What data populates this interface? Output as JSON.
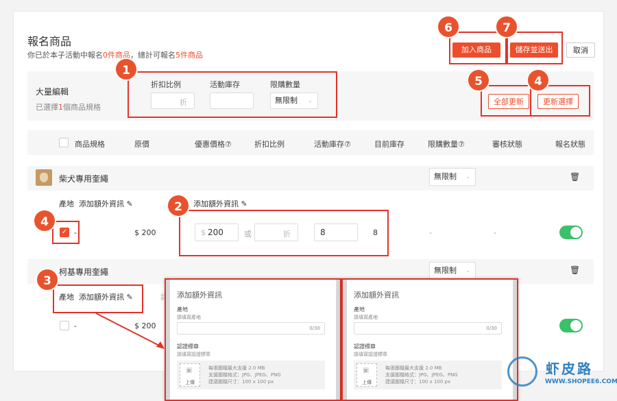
{
  "page": {
    "title": "報名商品",
    "subtitle_pre": "你已於本子活動中報名",
    "subtitle_c1": "0件商品",
    "subtitle_mid": "，總計可報名",
    "subtitle_c2": "5件商品"
  },
  "buttons": {
    "add": "加入商品",
    "save": "儲存並送出",
    "cancel": "取消",
    "update_all": "全部更新",
    "update_selected": "更新選擇"
  },
  "bulk": {
    "title": "大量編輯",
    "selected_pre": "已選擇",
    "selected_count": "1",
    "selected_post": "個商品規格",
    "discount_label": "折扣比例",
    "discount_unit": "折",
    "stock_label": "活動庫存",
    "limit_label": "限購數量",
    "limit_value": "無限制"
  },
  "table": {
    "headers": [
      "商品規格",
      "原價",
      "優惠價格⑦",
      "折扣比例",
      "活動庫存⑦",
      "目前庫存",
      "限購數量⑦",
      "審核狀態",
      "報名狀態"
    ]
  },
  "products": [
    {
      "name": "柴犬專用奎繩",
      "limit": "無限制",
      "info_label": "產地",
      "info_link": "添加額外資訊",
      "variant": "-",
      "price": "$ 200",
      "promo_currency": "$",
      "promo_price": "200",
      "or_text": "或",
      "discount_unit": "折",
      "stock": "8",
      "current_stock": "8",
      "dash1": "-",
      "dash2": "-"
    },
    {
      "name": "柯基專用奎繩",
      "limit": "無限制",
      "info_label": "產地",
      "info_link": "添加額外資訊",
      "variant": "-",
      "price": "$ 200"
    }
  ],
  "popup": {
    "title": "添加額外資訊",
    "field1": "產地",
    "field1_hint": "請填寫產地",
    "counter": "0/30",
    "field2": "認證標章",
    "field2_hint": "請填寫認證標章",
    "upload": "上傳",
    "req1": "每張圖檔最大支援 2.0 MB",
    "req2": "支援圖檔格式：JPG、JPEG、PNG",
    "req3": "建議圖檔尺寸：100 x 100 px"
  },
  "annotations": [
    "1",
    "2",
    "3",
    "4",
    "4",
    "5",
    "6",
    "7"
  ],
  "watermark": {
    "cn": "虾皮路",
    "url": "WWW.SHOPEE6.COM"
  },
  "colors": {
    "accent": "#ee4d2d",
    "annotation": "#e0322a",
    "toggle": "#3cc06a"
  }
}
